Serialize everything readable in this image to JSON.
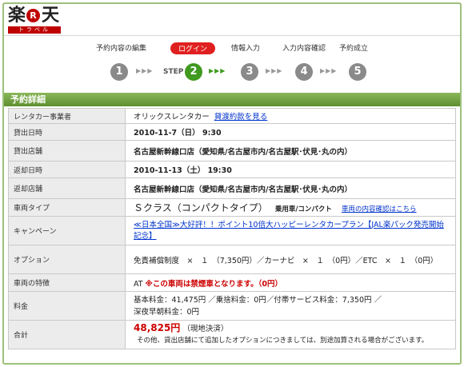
{
  "logo": {
    "char1": "楽",
    "r": "R",
    "char2": "天",
    "travel": "トラベル"
  },
  "steps": [
    {
      "label": "予約内容の編集",
      "number": "1"
    },
    {
      "label": "ログイン",
      "number": "2",
      "step_text": "STEP"
    },
    {
      "label": "情報入力",
      "number": "3"
    },
    {
      "label": "入力内容確認",
      "number": "4"
    },
    {
      "label": "予約成立",
      "number": "5"
    }
  ],
  "arrows": "▶▶▶",
  "section_title": "予約詳細",
  "rows": {
    "company": {
      "label": "レンタカー事業者",
      "value": "オリックスレンタカー",
      "link": "貸渡約款を見る"
    },
    "pickup_date": {
      "label": "貸出日時",
      "value": "2010-11-7（日） 9:30"
    },
    "pickup_store": {
      "label": "貸出店舗",
      "value": "名古屋新幹線口店（愛知県/名古屋市内/名古屋駅･伏見･丸の内）"
    },
    "return_date": {
      "label": "返却日時",
      "value": "2010-11-13（土） 19:30"
    },
    "return_store": {
      "label": "返却店舗",
      "value": "名古屋新幹線口店（愛知県/名古屋市内/名古屋駅･伏見･丸の内）"
    },
    "car_type": {
      "label": "車両タイプ",
      "value": "Ｓクラス（コンパクトタイプ）",
      "sub": "乗用車/コンパクト",
      "link": "車両の内容確認はこちら"
    },
    "campaign": {
      "label": "キャンペーン",
      "value": "≪日本全国≫大好評！！ポイント10倍大ハッピーレンタカープラン【JAL楽パック発売開始記念】"
    },
    "options": {
      "label": "オプション",
      "value": "免責補償制度　×　１　（7,350円）／カーナビ　×　１　（0円）／ETC　×　１　（0円）"
    },
    "features": {
      "label": "車両の特徴",
      "value_prefix": "AT",
      "value_note": "※この車両は禁煙車となります。（0円）"
    },
    "fee": {
      "label": "料金",
      "line1": "基本料金：41,475円 ／乗捨料金：0円／付帯サービス料金：7,350円 ／",
      "line2": "深夜早朝料金：0円"
    },
    "total": {
      "label": "合計",
      "amount": "48,825円",
      "note": "（現地決済）",
      "footnote": "その他、貸出店舗にて追加したオプションにつきましては、別途加算される場合がございます。"
    }
  }
}
